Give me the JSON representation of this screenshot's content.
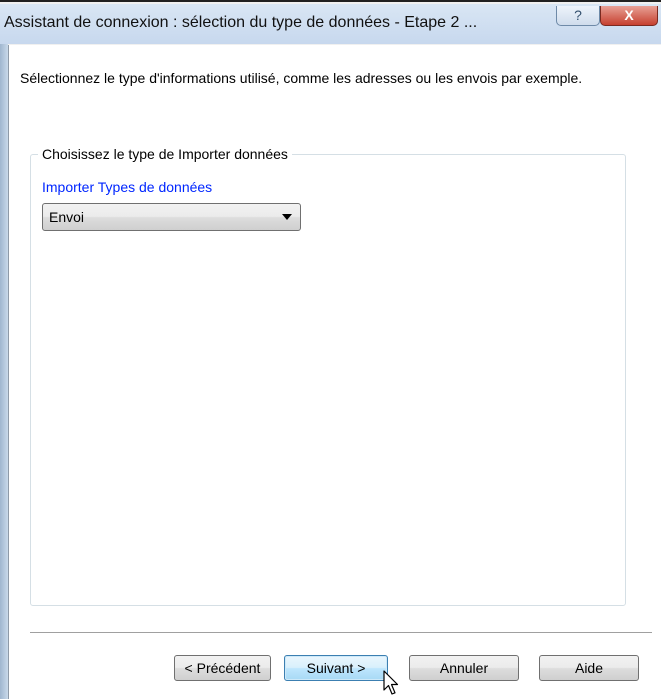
{
  "window": {
    "title": "Assistant de connexion : sélection du type de données - Etape 2 ...",
    "help_glyph": "?",
    "close_glyph": "X"
  },
  "instruction": "Sélectionnez le type d'informations utilisé, comme les adresses ou les envois par exemple.",
  "group": {
    "legend": "Choisissez le type de Importer données",
    "field_label": "Importer Types de données",
    "combo_value": "Envoi"
  },
  "buttons": {
    "previous": "< Précédent",
    "next": "Suivant >",
    "cancel": "Annuler",
    "help": "Aide"
  },
  "colors": {
    "field_label": "#0026ff",
    "close_button": "#c6402f",
    "titlebar": "#c7d8ee"
  },
  "icons": {
    "help": "help-icon",
    "close": "close-icon",
    "combo_arrow": "chevron-down-icon",
    "cursor": "mouse-pointer-icon"
  }
}
